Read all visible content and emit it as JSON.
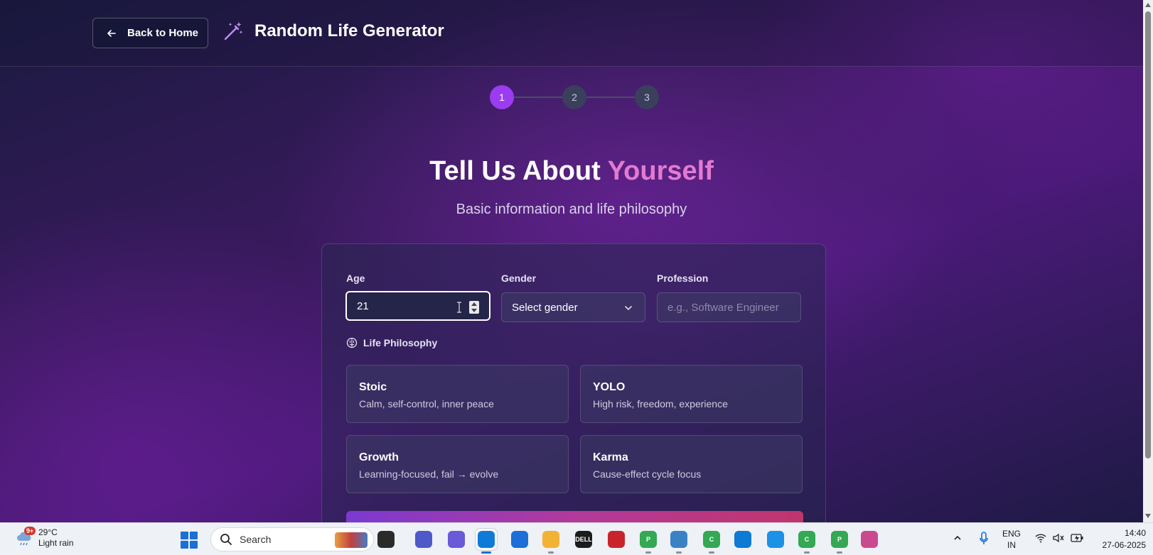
{
  "header": {
    "back_label": "Back to Home",
    "brand_title": "Random Life Generator",
    "icon": "magic-wand-icon"
  },
  "stepper": {
    "steps": [
      "1",
      "2",
      "3"
    ],
    "active_step": 1
  },
  "hero": {
    "title_main": "Tell Us About ",
    "title_accent": "Yourself",
    "subtitle": "Basic information and life philosophy"
  },
  "form": {
    "age": {
      "label": "Age",
      "value": "21"
    },
    "gender": {
      "label": "Gender",
      "value": "Select gender"
    },
    "profession": {
      "label": "Profession",
      "placeholder": "e.g., Software Engineer"
    },
    "philosophy_label": "Life Philosophy",
    "options": [
      {
        "title": "Stoic",
        "desc": "Calm, self-control, inner peace"
      },
      {
        "title": "YOLO",
        "desc": "High risk, freedom, experience"
      },
      {
        "title": "Growth",
        "desc": "Learning-focused, fail → evolve"
      },
      {
        "title": "Karma",
        "desc": "Cause-effect cycle focus"
      }
    ]
  },
  "colors": {
    "accent": "#9b3cf0",
    "heading_accent": "#e47ad0"
  },
  "taskbar": {
    "weather_badge": "9+",
    "temperature": "29°C",
    "condition": "Light rain",
    "search_label": "Search",
    "language_line1": "ENG",
    "language_line2": "IN",
    "time": "14:40",
    "date": "27-06-2025",
    "apps": [
      {
        "name": "widgets-app",
        "label": ""
      },
      {
        "name": "teams-app",
        "label": ""
      },
      {
        "name": "copilot-app",
        "label": ""
      },
      {
        "name": "edge-app",
        "label": ""
      },
      {
        "name": "store-app",
        "label": ""
      },
      {
        "name": "file-explorer-app",
        "label": ""
      },
      {
        "name": "dell-app",
        "label": "DELL"
      },
      {
        "name": "pdf-app",
        "label": ""
      },
      {
        "name": "chrome-profile-p-app",
        "label": "P"
      },
      {
        "name": "notepad-app",
        "label": ""
      },
      {
        "name": "chrome-profile-c-app",
        "label": "C"
      },
      {
        "name": "vscode-app",
        "label": ""
      },
      {
        "name": "docker-app",
        "label": ""
      },
      {
        "name": "chrome-profile-c2-app",
        "label": "C"
      },
      {
        "name": "chrome-profile-p2-app",
        "label": "P"
      },
      {
        "name": "snipping-tool-app",
        "label": ""
      }
    ]
  }
}
